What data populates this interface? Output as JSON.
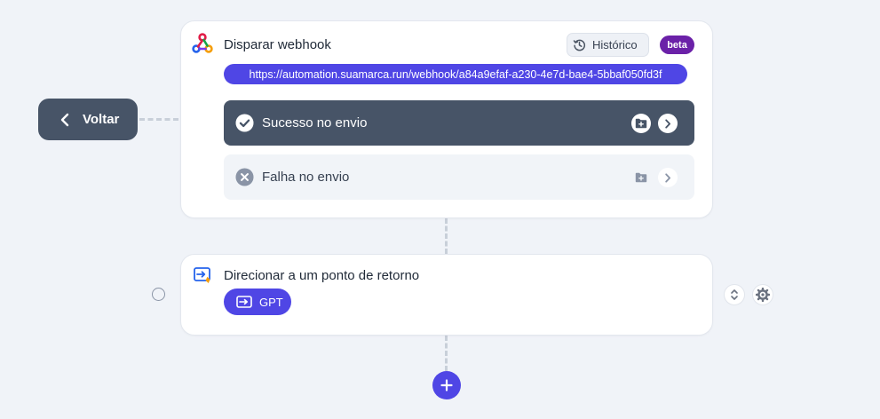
{
  "back": {
    "label": "Voltar"
  },
  "webhook": {
    "title": "Disparar webhook",
    "history_label": "Histórico",
    "beta_label": "beta",
    "url": "https://automation.suamarca.run/webhook/a84a9efaf-a230-4e7d-bae4-5bbaf050fd3f",
    "success_label": "Sucesso no envio",
    "fail_label": "Falha no envio"
  },
  "redirect": {
    "title": "Direcionar a um ponto de retorno",
    "gpt_label": "GPT"
  },
  "colors": {
    "accent": "#4f46e5",
    "dark": "#475467",
    "beta": "#6b21a8",
    "background": "#f0f3f8"
  },
  "icons": {
    "webhook": "webhook-icon",
    "history": "history-icon",
    "success": "check-circle-icon",
    "fail": "x-circle-icon",
    "folder": "folder-add-icon",
    "arrow": "chevron-right-icon",
    "redirect": "redirect-icon",
    "gpt": "enter-icon",
    "sort": "sort-icon",
    "gear": "gear-icon",
    "add": "plus-icon",
    "back": "chevron-left-icon"
  }
}
